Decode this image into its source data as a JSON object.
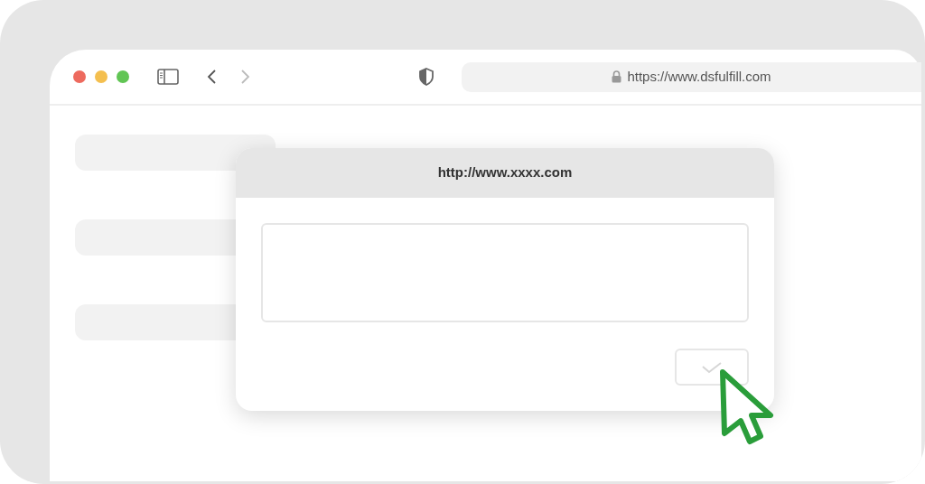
{
  "browser": {
    "navigation": [
      {
        "kind": "back",
        "disabled": false
      },
      {
        "kind": "forward",
        "disabled": true
      }
    ],
    "url": "https://www.dsfulfill.com"
  },
  "dialog": {
    "title": "http://www.xxxx.com"
  }
}
